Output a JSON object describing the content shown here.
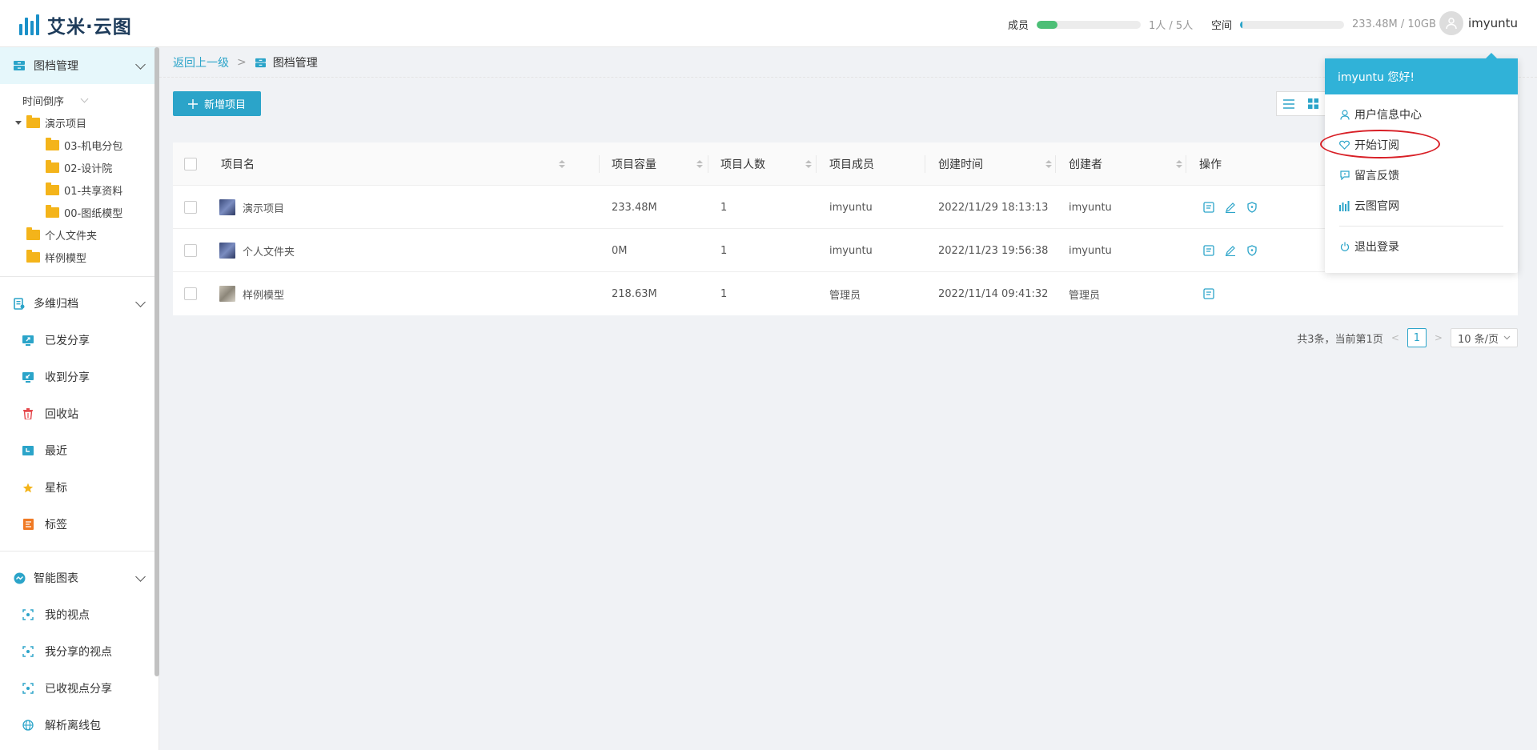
{
  "app": {
    "logo_text": "艾米·云图"
  },
  "header": {
    "members": {
      "label": "成员",
      "value_text": "1人 / 5人",
      "fill_fraction": 0.2,
      "color": "#4cbf76"
    },
    "space": {
      "label": "空间",
      "value_text": "233.48M / 10GB",
      "fill_fraction": 0.023,
      "color": "#2ba4c9"
    },
    "username": "imyuntu"
  },
  "sidebar": {
    "archive": {
      "title": "图档管理",
      "sort_label": "时间倒序",
      "tree": {
        "root": "演示项目",
        "children": [
          "03-机电分包",
          "02-设计院",
          "01-共享资料",
          "00-图纸模型"
        ],
        "siblings": [
          "个人文件夹",
          "样例模型"
        ]
      }
    },
    "multi": {
      "title": "多维归档",
      "items": [
        "已发分享",
        "收到分享",
        "回收站",
        "最近",
        "星标",
        "标签"
      ]
    },
    "smart": {
      "title": "智能图表",
      "items": [
        "我的视点",
        "我分享的视点",
        "已收视点分享",
        "解析离线包"
      ]
    }
  },
  "breadcrumb": {
    "back": "返回上一级",
    "sep": ">",
    "current": "图档管理"
  },
  "toolbar": {
    "add_label": "新增项目"
  },
  "table": {
    "columns": [
      "项目名",
      "项目容量",
      "项目人数",
      "项目成员",
      "创建时间",
      "创建者",
      "操作"
    ],
    "rows": [
      {
        "name": "演示项目",
        "size": "233.48M",
        "count": "1",
        "members": "imyuntu",
        "created": "2022/11/29 18:13:13",
        "creator": "imyuntu"
      },
      {
        "name": "个人文件夹",
        "size": "0M",
        "count": "1",
        "members": "imyuntu",
        "created": "2022/11/23 19:56:38",
        "creator": "imyuntu"
      },
      {
        "name": "样例模型",
        "size": "218.63M",
        "count": "1",
        "members": "管理员",
        "created": "2022/11/14 09:41:32",
        "creator": "管理员"
      }
    ]
  },
  "pager": {
    "summary": "共3条，当前第1页",
    "current": "1",
    "page_size": "10 条/页"
  },
  "user_menu": {
    "greeting": "imyuntu 您好!",
    "items": [
      "用户信息中心",
      "开始订阅",
      "留言反馈",
      "云图官网"
    ],
    "logout": "退出登录"
  },
  "colors": {
    "accent": "#2ba4c9",
    "menu_head": "#30b2d8",
    "highlight": "#d81f26"
  }
}
